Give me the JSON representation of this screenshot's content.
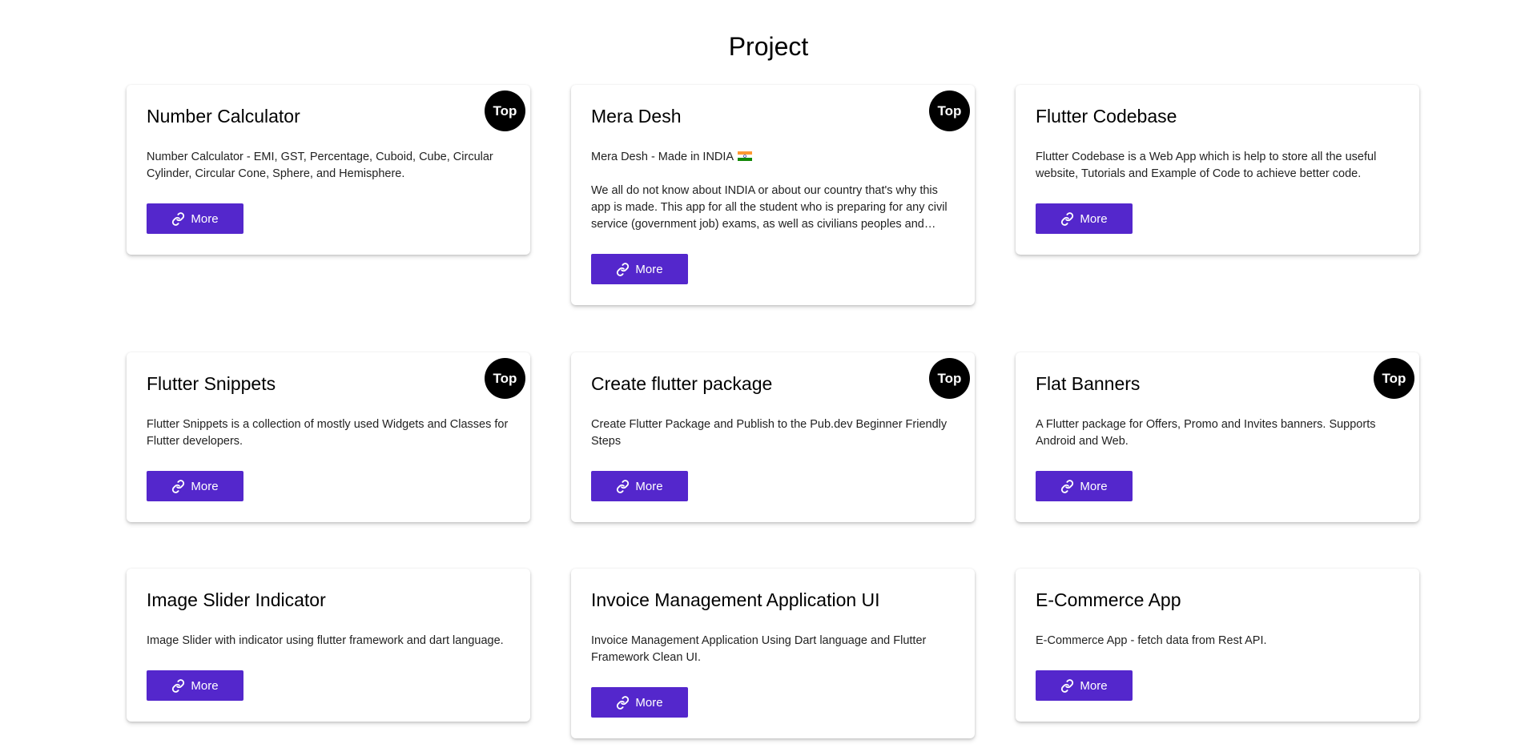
{
  "page": {
    "title": "Project"
  },
  "colors": {
    "button_bg": "#5427cc",
    "badge_bg": "#000000",
    "card_bg": "#ffffff"
  },
  "cards": [
    {
      "title": "Number Calculator",
      "badge": "Top",
      "description": [
        "Number Calculator - EMI, GST, Percentage, Cuboid, Cube, Circular Cylinder, Circular Cone, Sphere, and Hemisphere."
      ],
      "button_label": "More",
      "button_icon": "link-icon"
    },
    {
      "title": "Mera Desh",
      "badge": "Top",
      "description": [
        "Mera Desh - Made in INDIA",
        "We all do not know about INDIA or about our country that's why this app is made. This app for all the student who is preparing for any civil service (government job) exams, as well as civilians peoples and tourists."
      ],
      "title_flag_icon": "india-flag-icon",
      "button_label": "More",
      "button_icon": "link-icon"
    },
    {
      "title": "Flutter Codebase",
      "badge": "",
      "description": [
        "Flutter Codebase is a Web App which is help to store all the useful website, Tutorials and Example of Code to achieve better code."
      ],
      "button_label": "More",
      "button_icon": "link-icon"
    },
    {
      "title": "Flutter Snippets",
      "badge": "Top",
      "description": [
        "Flutter Snippets is a collection of mostly used Widgets and Classes for Flutter developers."
      ],
      "button_label": "More",
      "button_icon": "link-icon"
    },
    {
      "title": "Create flutter package",
      "badge": "Top",
      "description": [
        "Create Flutter Package and Publish to the Pub.dev Beginner Friendly Steps"
      ],
      "button_label": "More",
      "button_icon": "link-icon"
    },
    {
      "title": "Flat Banners",
      "badge": "Top",
      "description": [
        "A Flutter package for Offers, Promo and Invites banners. Supports Android and Web."
      ],
      "button_label": "More",
      "button_icon": "link-icon"
    },
    {
      "title": "Image Slider Indicator",
      "badge": "",
      "description": [
        "Image Slider with indicator using flutter framework and dart language."
      ],
      "button_label": "More",
      "button_icon": "link-icon"
    },
    {
      "title": "Invoice Management Application UI",
      "badge": "",
      "description": [
        "Invoice Management Application Using Dart language and Flutter Framework Clean UI."
      ],
      "button_label": "More",
      "button_icon": "link-icon"
    },
    {
      "title": "E-Commerce App",
      "badge": "",
      "description": [
        "E-Commerce App - fetch data from Rest API."
      ],
      "button_label": "More",
      "button_icon": "link-icon"
    }
  ]
}
